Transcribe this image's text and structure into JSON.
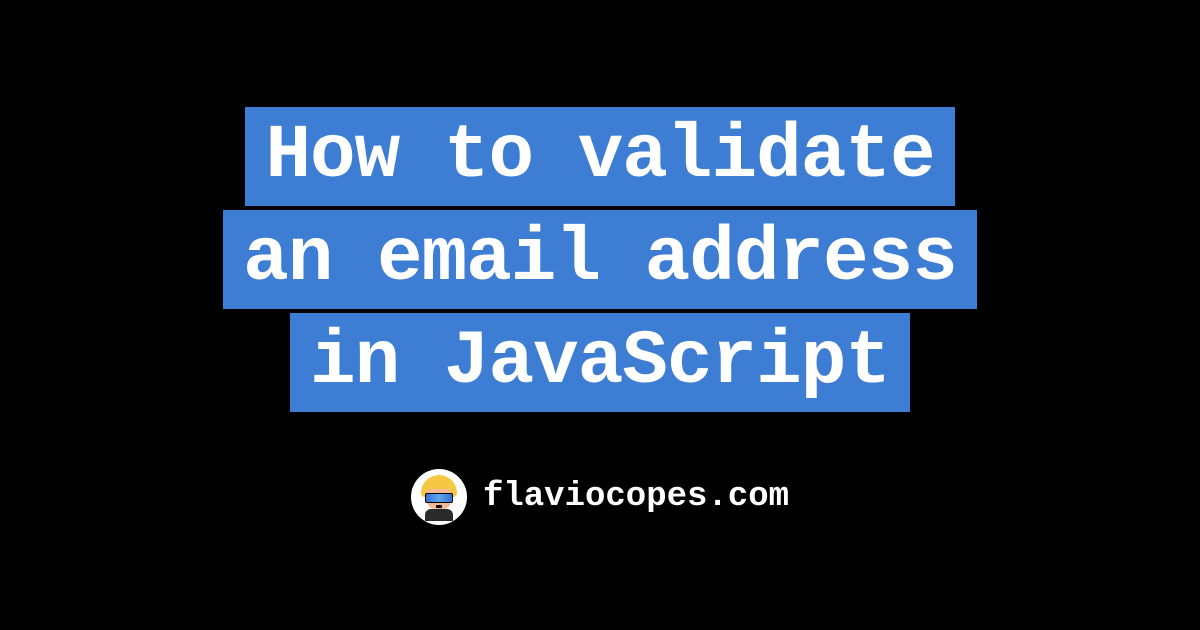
{
  "title": {
    "line1": "How to validate",
    "line2": "an email address",
    "line3": "in JavaScript"
  },
  "footer": {
    "site_name": "flaviocopes.com"
  }
}
